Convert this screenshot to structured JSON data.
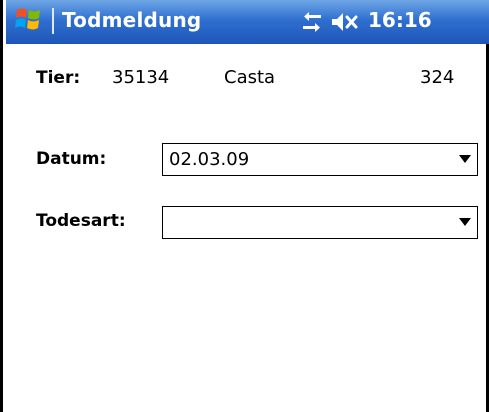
{
  "titlebar": {
    "title": "Todmeldung",
    "time": "16:16",
    "icons": [
      "windows-start-icon",
      "connectivity-icon",
      "volume-muted-icon"
    ]
  },
  "animal": {
    "label": "Tier:",
    "id": "35134",
    "name": "Casta",
    "number": "324"
  },
  "form": {
    "date": {
      "label": "Datum:",
      "value": "02.03.09"
    },
    "cause": {
      "label": "Todesart:",
      "value": ""
    }
  },
  "colors": {
    "titlebar_top": "#6fa6e6",
    "titlebar_bottom": "#1d56b8",
    "background": "#ffffff"
  }
}
